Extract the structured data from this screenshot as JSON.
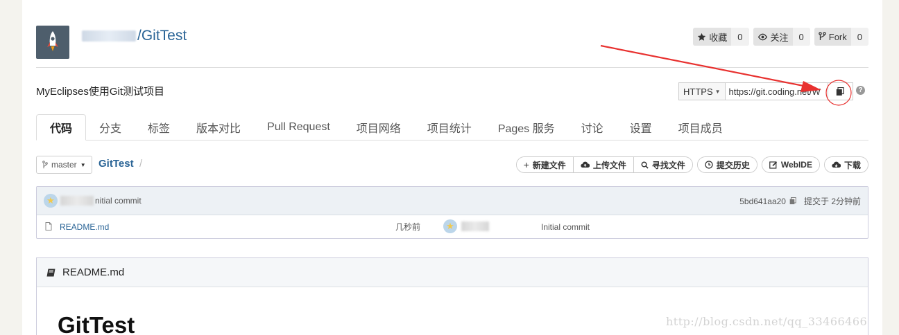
{
  "repo": {
    "name": "/GitTest",
    "description": "MyEclipses使用Git测试项目"
  },
  "header_buttons": [
    {
      "icon": "star-icon",
      "label": "收藏",
      "count": "0"
    },
    {
      "icon": "eye-icon",
      "label": "关注",
      "count": "0"
    },
    {
      "icon": "fork-icon",
      "label": "Fork",
      "count": "0"
    }
  ],
  "clone": {
    "protocol": "HTTPS",
    "url": "https://git.coding.net/W"
  },
  "tabs": [
    {
      "label": "代码",
      "active": true
    },
    {
      "label": "分支"
    },
    {
      "label": "标签"
    },
    {
      "label": "版本对比"
    },
    {
      "label": "Pull Request"
    },
    {
      "label": "项目网络"
    },
    {
      "label": "项目统计"
    },
    {
      "label": "Pages 服务"
    },
    {
      "label": "讨论"
    },
    {
      "label": "设置"
    },
    {
      "label": "项目成员"
    }
  ],
  "branch": {
    "name": "master"
  },
  "breadcrumb": {
    "root": "GitTest",
    "sep": "/"
  },
  "actions": {
    "new_file": "新建文件",
    "upload": "上传文件",
    "find": "寻找文件",
    "history": "提交历史",
    "webide": "WebIDE",
    "download": "下载"
  },
  "last_commit": {
    "message": "nitial commit",
    "hash": "5bd641aa20",
    "time": "提交于 2分钟前"
  },
  "files": [
    {
      "name": "README.md",
      "time": "几秒前",
      "message": "Initial commit"
    }
  ],
  "readme": {
    "title": "README.md",
    "h1": "GitTest"
  },
  "watermark": "http://blog.csdn.net/qq_33466466",
  "colors": {
    "link": "#2a6496",
    "annotation": "#e8312f"
  }
}
